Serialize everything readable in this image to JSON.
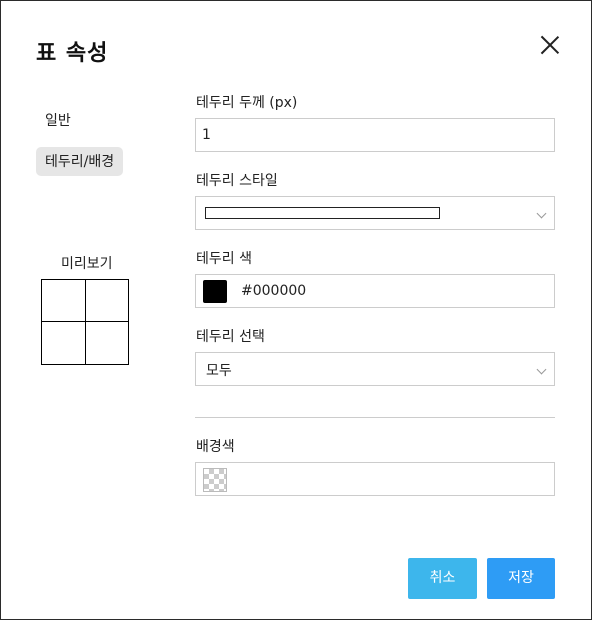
{
  "dialog": {
    "title": "표 속성",
    "close_icon": "close-icon"
  },
  "nav": {
    "general": "일반",
    "border_bg": "테두리/배경"
  },
  "preview": {
    "label": "미리보기"
  },
  "border_width": {
    "label": "테두리 두께 (px)",
    "value": "1"
  },
  "border_style": {
    "label": "테두리 스타일",
    "value": "solid"
  },
  "border_color": {
    "label": "테두리 색",
    "value": "#000000",
    "swatch_color": "#000000"
  },
  "border_select": {
    "label": "테두리 선택",
    "value": "모두"
  },
  "background": {
    "label": "배경색",
    "value": "transparent"
  },
  "buttons": {
    "cancel": "취소",
    "save": "저장"
  }
}
